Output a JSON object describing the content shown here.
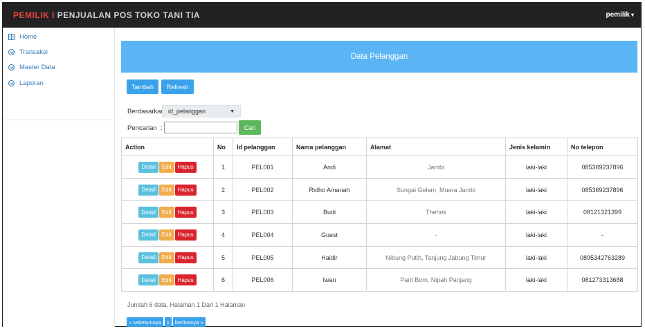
{
  "topbar": {
    "brand_prefix": "PEMILIK",
    "brand_sep": " I ",
    "brand_rest": "PENJUALAN POS TOKO TANI TIA",
    "user": "pemilik",
    "user_caret": "▾"
  },
  "sidebar": {
    "items": [
      {
        "label": "Home",
        "icon": "grid-icon"
      },
      {
        "label": "Transaksi",
        "icon": "chevron-circle-icon"
      },
      {
        "label": "Master Data",
        "icon": "chevron-circle-icon"
      },
      {
        "label": "Laporan",
        "icon": "chevron-circle-icon"
      }
    ]
  },
  "panel": {
    "title": "Data Pelanggan"
  },
  "toolbar": {
    "tambah": "Tambah",
    "refresh": "Refresh"
  },
  "filter": {
    "by_label": "Berdasarkan:",
    "by_value": "id_pelanggan",
    "search_label": "Pencarian",
    "search_colon": ":",
    "search_value": "",
    "cari": "Cari"
  },
  "table": {
    "headers": [
      "Action",
      "No",
      "Id pelanggan",
      "Nama pelanggan",
      "Alamat",
      "Jenis kelamin",
      "No telepon"
    ],
    "actions": {
      "detail": "Detail",
      "edit": "Edit",
      "hapus": "Hapus"
    },
    "rows": [
      {
        "no": "1",
        "id": "PEL001",
        "nama": "Andi",
        "alamat": "Jambi",
        "jk": "laki-laki",
        "telp": "085369237896"
      },
      {
        "no": "2",
        "id": "PEL002",
        "nama": "Ridho Amanah",
        "alamat": "Sungai Gelam, Muara Jambi",
        "jk": "laki-laki",
        "telp": "085369237896"
      },
      {
        "no": "3",
        "id": "PEL003",
        "nama": "Budi",
        "alamat": "Thehok",
        "jk": "laki-laki",
        "telp": "08121321399"
      },
      {
        "no": "4",
        "id": "PEL004",
        "nama": "Guest",
        "alamat": "-",
        "jk": "laki-laki",
        "telp": "-"
      },
      {
        "no": "5",
        "id": "PEL005",
        "nama": "Haidir",
        "alamat": "Nibung Putih, Tanjung Jabung Timur",
        "jk": "laki-laki",
        "telp": "0895342763289"
      },
      {
        "no": "6",
        "id": "PEL006",
        "nama": "Iwan",
        "alamat": "Parit Bom, Nipah Panjang",
        "jk": "laki-laki",
        "telp": "081273313688"
      }
    ]
  },
  "summary": "Jumlah 6 data, Halaman 1 Dari 1 Halaman",
  "pager": {
    "prev": "« sebelumnya",
    "page": "1",
    "next": "berikutnya »"
  },
  "colors": {
    "topbar": "#222222",
    "panel_head": "#5bb4f3",
    "primary": "#3aa2ea",
    "success": "#5cb85c",
    "info": "#5bc0de",
    "warning": "#f0ad4e",
    "danger": "#d9232e"
  }
}
